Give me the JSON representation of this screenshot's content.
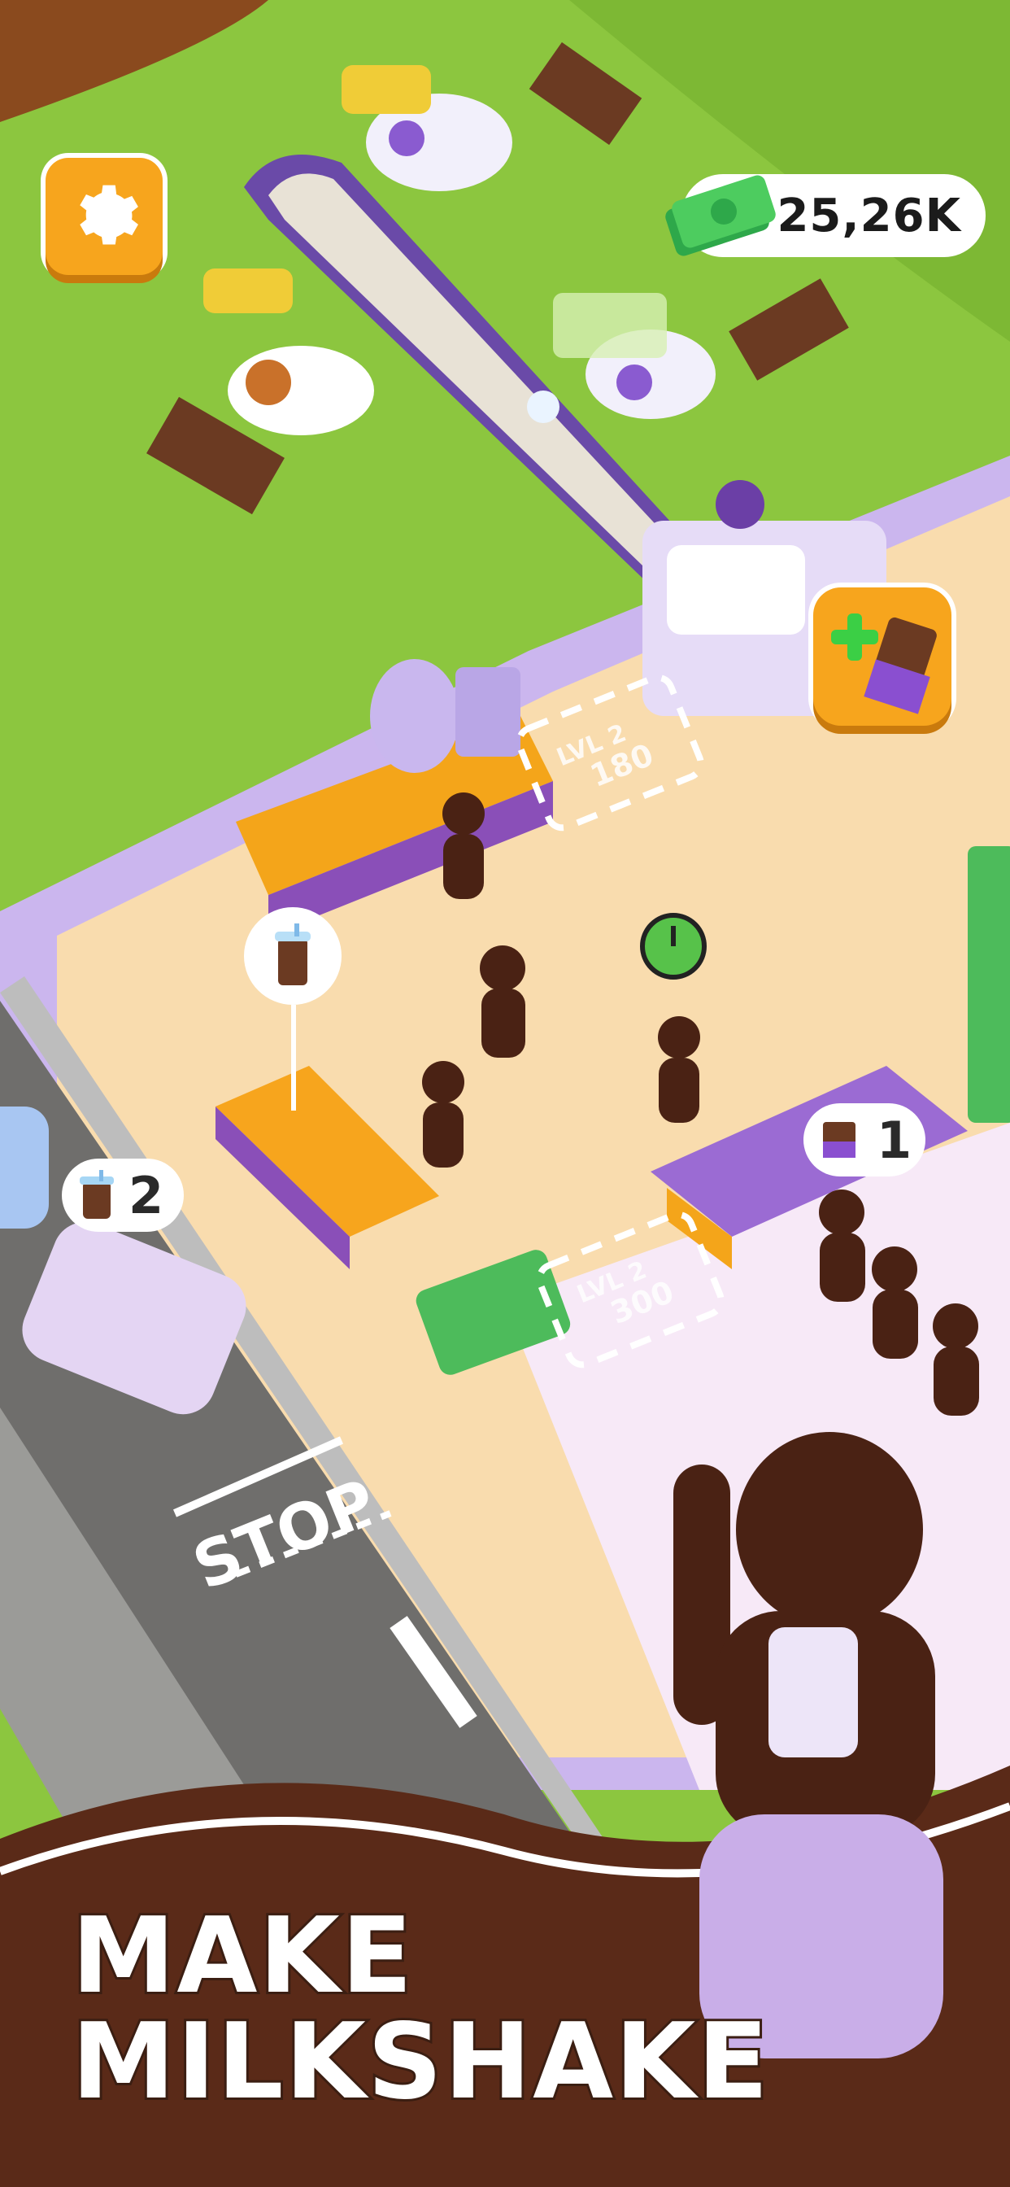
{
  "hud": {
    "settings_icon": "gear-icon",
    "money_value": "25,26K",
    "money_icon": "cash-stack-icon",
    "add_chocolate_icon": "chocolate-plus-icon"
  },
  "upgrade_pads": [
    {
      "level": "LVL 2",
      "cost": "180"
    },
    {
      "level": "LVL 2",
      "cost": "300"
    }
  ],
  "order_bubbles": {
    "car_order_count": "2",
    "counter_order_count": "1"
  },
  "road": {
    "stop_marking": "STOP"
  },
  "banner": {
    "line1": "MAKE",
    "line2": "MILKSHAKE"
  },
  "colors": {
    "grass": "#8cc63f",
    "floor": "#f9dcae",
    "purple": "#9b6bd3",
    "orange": "#f7a51d",
    "chocolate": "#5a2a18",
    "road": "#6f6e6c"
  }
}
